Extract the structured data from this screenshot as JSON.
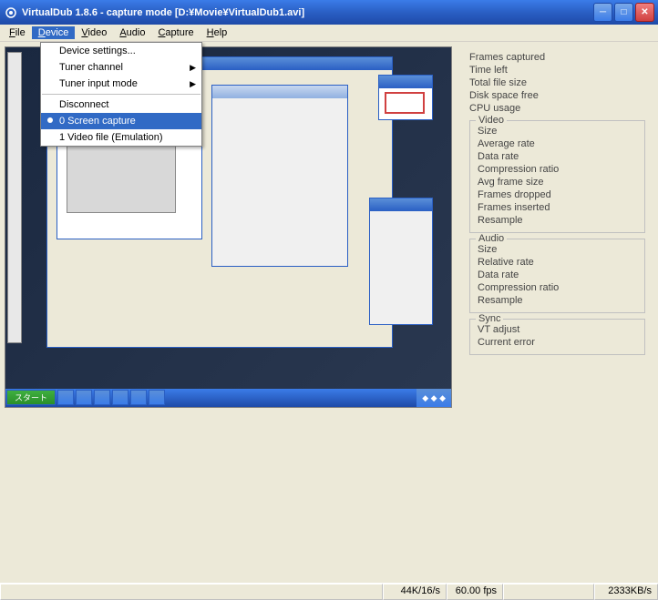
{
  "window": {
    "title": "VirtualDub 1.8.6 - capture mode [D:¥Movie¥VirtualDub1.avi]"
  },
  "menubar": {
    "file": "File",
    "device": "Device",
    "video": "Video",
    "audio": "Audio",
    "capture": "Capture",
    "help": "Help"
  },
  "dropdown": {
    "device_settings": "Device settings...",
    "tuner_channel": "Tuner channel",
    "tuner_input_mode": "Tuner input mode",
    "disconnect": "Disconnect",
    "screen_capture": "0 Screen capture",
    "video_file": "1 Video file (Emulation)"
  },
  "side": {
    "frames_captured": "Frames captured",
    "time_left": "Time left",
    "total_file_size": "Total file size",
    "disk_space_free": "Disk space free",
    "cpu_usage": "CPU usage",
    "video_legend": "Video",
    "v_size": "Size",
    "v_avg_rate": "Average rate",
    "v_data_rate": "Data rate",
    "v_comp_ratio": "Compression ratio",
    "v_avg_frame": "Avg frame size",
    "v_dropped": "Frames dropped",
    "v_inserted": "Frames inserted",
    "v_resample": "Resample",
    "audio_legend": "Audio",
    "a_size": "Size",
    "a_rel_rate": "Relative rate",
    "a_data_rate": "Data rate",
    "a_comp_ratio": "Compression ratio",
    "a_resample": "Resample",
    "sync_legend": "Sync",
    "s_vt_adjust": "VT adjust",
    "s_cur_err": "Current error"
  },
  "status": {
    "cell1": "44K/16/s",
    "cell2": "60.00 fps",
    "cell3": "",
    "cell4": "2333KB/s"
  }
}
